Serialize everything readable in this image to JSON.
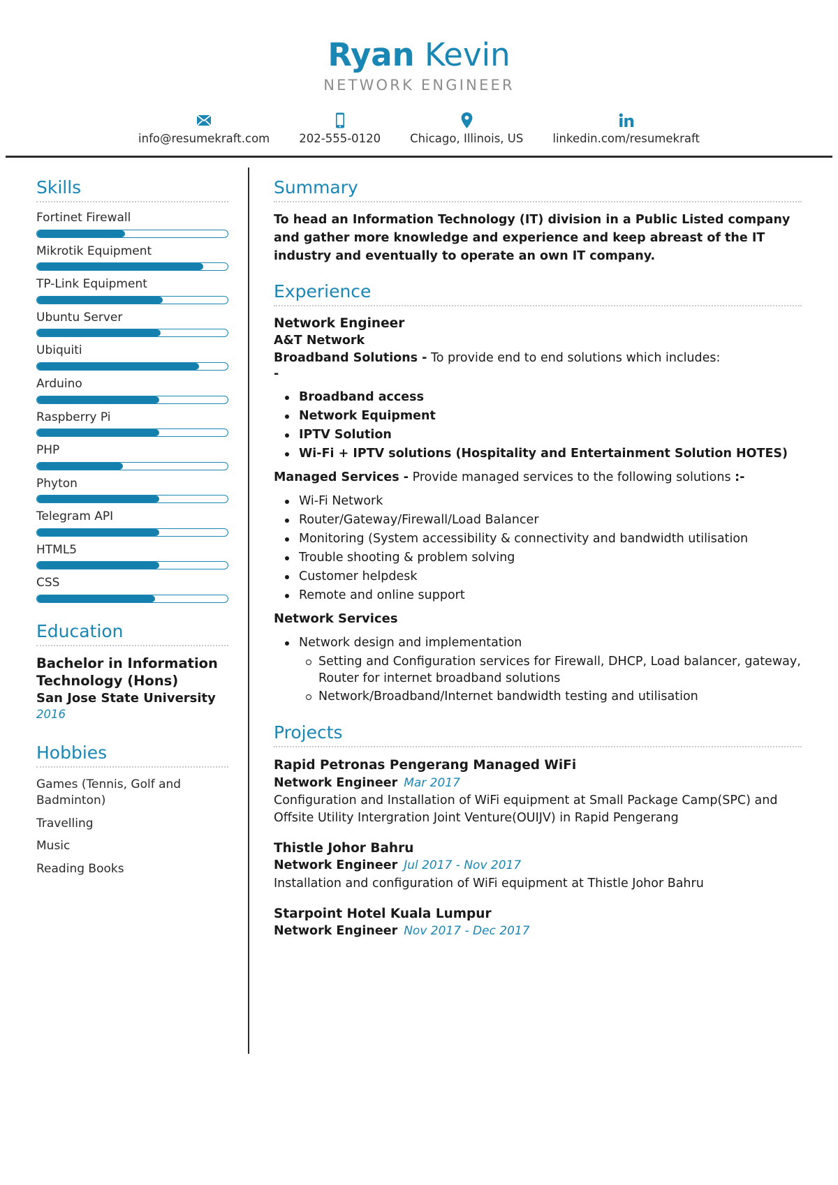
{
  "theme": {
    "accent": "#1a86b4",
    "bar_fill": "#1580ad",
    "text": "#1a1a1a",
    "muted": "#8c8c8c",
    "rule": "#2b2b2b"
  },
  "header": {
    "first_name": "Ryan",
    "last_name": "Kevin",
    "job_title": "NETWORK ENGINEER",
    "contacts": [
      {
        "icon": "envelope-icon",
        "text": "info@resumekraft.com"
      },
      {
        "icon": "mobile-phone-icon",
        "text": "202-555-0120"
      },
      {
        "icon": "location-pin-icon",
        "text": "Chicago, Illinois, US"
      },
      {
        "icon": "linkedin-icon",
        "text": "linkedin.com/resumekraft"
      }
    ]
  },
  "sidebar": {
    "skills": {
      "title": "Skills",
      "items": [
        {
          "label": "Fortinet Firewall",
          "level": 46
        },
        {
          "label": "Mikrotik Equipment",
          "level": 87
        },
        {
          "label": "TP-Link Equipment",
          "level": 66
        },
        {
          "label": "Ubuntu Server",
          "level": 65
        },
        {
          "label": "Ubiquiti",
          "level": 85
        },
        {
          "label": "Arduino",
          "level": 64
        },
        {
          "label": "Raspberry Pi",
          "level": 64
        },
        {
          "label": "PHP",
          "level": 45
        },
        {
          "label": "Phyton",
          "level": 64
        },
        {
          "label": "Telegram API",
          "level": 64
        },
        {
          "label": "HTML5",
          "level": 64
        },
        {
          "label": "CSS",
          "level": 62
        }
      ]
    },
    "education": {
      "title": "Education",
      "degree": "Bachelor in Information Technology (Hons)",
      "school": "San Jose State University",
      "year": "2016"
    },
    "hobbies": {
      "title": "Hobbies",
      "items": [
        "Games (Tennis, Golf and Badminton)",
        "Travelling",
        "Music",
        "Reading Books"
      ]
    }
  },
  "main": {
    "summary": {
      "title": "Summary",
      "text": "To head an Information Technology (IT) division in a Public Listed company and gather more knowledge and experience and keep abreast of the IT industry and eventually to operate an own IT company."
    },
    "experience": {
      "title": "Experience",
      "role": "Network Engineer",
      "company": "A&T Network",
      "broadband_label": "Broadband Solutions -",
      "broadband_text": " To provide end to end solutions which includes:",
      "broadband_dash": "-",
      "broadband_items": [
        "Broadband access",
        "Network Equipment",
        "IPTV Solution",
        "Wi-Fi + IPTV solutions (Hospitality and Entertainment Solution HOTES)"
      ],
      "managed_label": "Managed Services -",
      "managed_text": " Provide managed services to the following solutions ",
      "managed_suffix": ":-",
      "managed_items": [
        "Wi-Fi Network",
        "Router/Gateway/Firewall/Load Balancer",
        "Monitoring (System accessibility & connectivity and bandwidth utilisation",
        "Trouble shooting & problem solving",
        "Customer helpdesk",
        "Remote and online support"
      ],
      "network_services_label": "Network Services",
      "network_services_items": [
        "Network design and implementation"
      ],
      "network_services_subitems": [
        "Setting and Configuration services for Firewall, DHCP, Load balancer, gateway, Router for internet broadband solutions",
        "Network/Broadband/Internet bandwidth testing and utilisation"
      ]
    },
    "projects": {
      "title": "Projects",
      "items": [
        {
          "name": "Rapid Petronas Pengerang Managed WiFi",
          "role": "Network Engineer",
          "date": "Mar 2017",
          "desc": "Configuration and Installation of WiFi equipment at Small Package Camp(SPC) and Offsite Utility Intergration Joint Venture(OUIJV) in Rapid Pengerang"
        },
        {
          "name": "Thistle Johor Bahru",
          "role": "Network Engineer",
          "date": "Jul 2017 - Nov 2017",
          "desc": "Installation and configuration of WiFi equipment at Thistle Johor Bahru"
        },
        {
          "name": "Starpoint Hotel Kuala Lumpur",
          "role": "Network Engineer",
          "date": "Nov 2017 - Dec 2017",
          "desc": ""
        }
      ]
    }
  }
}
